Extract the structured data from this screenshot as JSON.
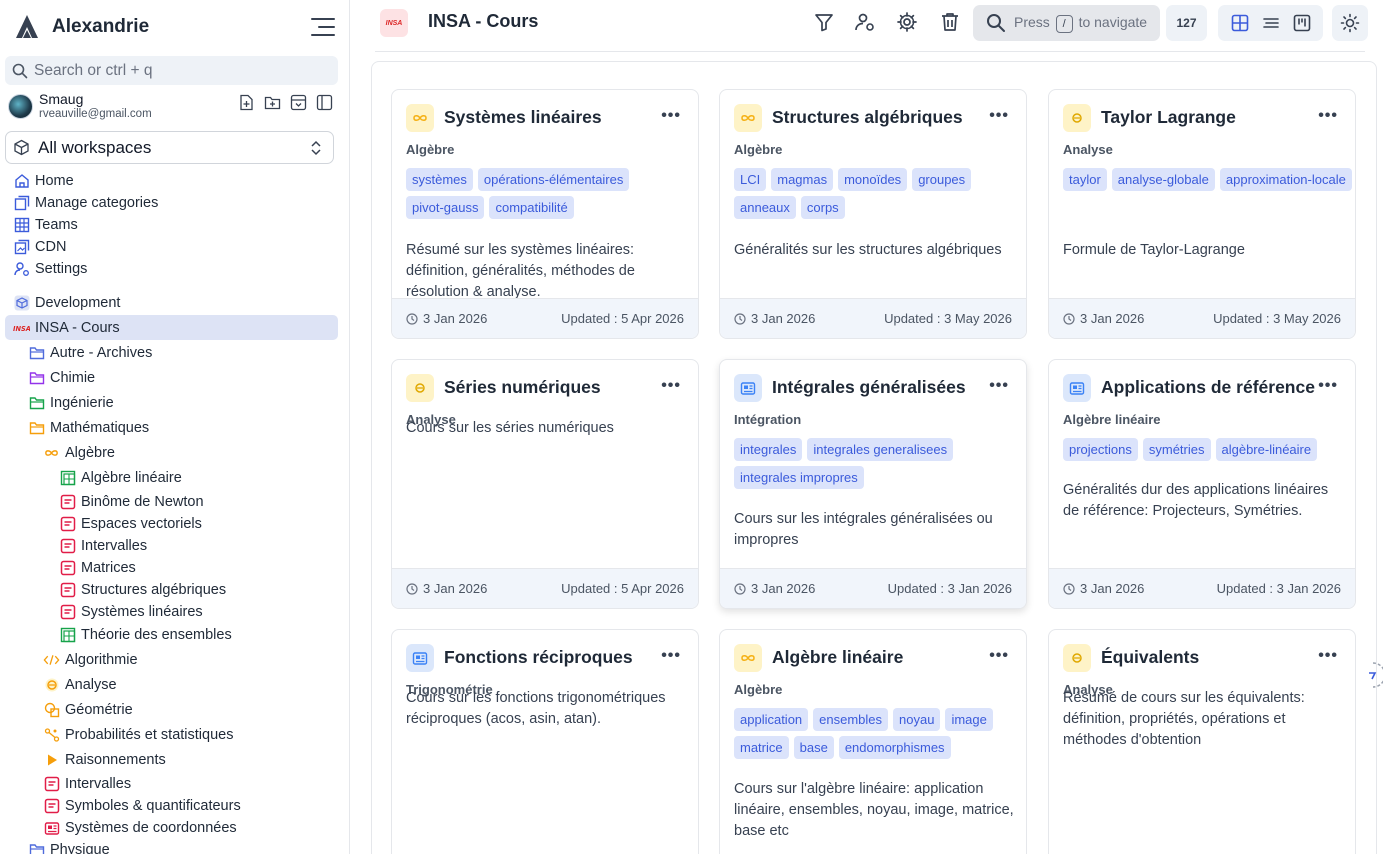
{
  "app": {
    "name": "Alexandrie"
  },
  "search": {
    "placeholder": "Search or ctrl + q"
  },
  "user": {
    "name": "Smaug",
    "email": "rveauville@gmail.com"
  },
  "workspace": {
    "label": "All workspaces"
  },
  "nav": [
    {
      "label": "Home",
      "icon": "home-icon"
    },
    {
      "label": "Manage categories",
      "icon": "categories-icon"
    },
    {
      "label": "Teams",
      "icon": "teams-icon"
    },
    {
      "label": "CDN",
      "icon": "cdn-icon"
    },
    {
      "label": "Settings",
      "icon": "settings-icon"
    }
  ],
  "tree": [
    {
      "label": "Development",
      "icon": "cube-icon",
      "color": "#4f6bdc"
    },
    {
      "label": "INSA - Cours",
      "icon": "insa-logo",
      "color": "#dc2626"
    },
    {
      "label": "Autre - Archives",
      "icon": "folder-icon",
      "color": "#4f6bdc"
    },
    {
      "label": "Chimie",
      "icon": "folder-icon",
      "color": "#9333ea"
    },
    {
      "label": "Ingénierie",
      "icon": "folder-icon",
      "color": "#16a34a"
    },
    {
      "label": "Mathématiques",
      "icon": "folder-icon",
      "color": "#f59e0b"
    },
    {
      "label": "Algèbre",
      "icon": "infinity-icon",
      "color": "#f59e0b"
    },
    {
      "label": "Algèbre linéaire",
      "icon": "board-icon",
      "color": "#16a34a"
    },
    {
      "label": "Binôme de Newton",
      "icon": "doc-icon",
      "color": "#e11d48"
    },
    {
      "label": "Espaces vectoriels",
      "icon": "doc-icon",
      "color": "#e11d48"
    },
    {
      "label": "Intervalles",
      "icon": "doc-icon",
      "color": "#e11d48"
    },
    {
      "label": "Matrices",
      "icon": "doc-icon",
      "color": "#e11d48"
    },
    {
      "label": "Structures algébriques",
      "icon": "doc-icon",
      "color": "#e11d48"
    },
    {
      "label": "Systèmes linéaires",
      "icon": "doc-icon",
      "color": "#e11d48"
    },
    {
      "label": "Théorie des ensembles",
      "icon": "board-icon",
      "color": "#16a34a"
    },
    {
      "label": "Algorithmie",
      "icon": "code-icon",
      "color": "#f59e0b"
    },
    {
      "label": "Analyse",
      "icon": "analysis-icon",
      "color": "#f59e0b"
    },
    {
      "label": "Géométrie",
      "icon": "geometry-icon",
      "color": "#f59e0b"
    },
    {
      "label": "Probabilités et statistiques",
      "icon": "stats-icon",
      "color": "#f59e0b"
    },
    {
      "label": "Raisonnements",
      "icon": "play-icon",
      "color": "#f59e0b"
    },
    {
      "label": "Intervalles",
      "icon": "doc-icon",
      "color": "#e11d48"
    },
    {
      "label": "Symboles & quantificateurs",
      "icon": "doc-icon",
      "color": "#e11d48"
    },
    {
      "label": "Systèmes de coordonnées",
      "icon": "news-icon",
      "color": "#e11d48"
    },
    {
      "label": "Physique",
      "icon": "folder-icon",
      "color": "#4f6bdc"
    }
  ],
  "topbar": {
    "title": "INSA - Cours",
    "logo_text": "INSA",
    "command": {
      "before": "Press",
      "key": "/",
      "after": "to navigate"
    },
    "count": "127"
  },
  "cards": [
    {
      "title": "Systèmes linéaires",
      "category": "Algèbre",
      "icon": "infinity-icon",
      "tags": [
        "systèmes",
        "opérations-élémentaires",
        "pivot-gauss",
        "compatibilité"
      ],
      "description": "Résumé sur les systèmes linéaires: définition, généralités, méthodes de résolution & analyse.",
      "created": "3 Jan 2026",
      "updated": "Updated : 5 Apr 2026"
    },
    {
      "title": "Structures algébriques",
      "category": "Algèbre",
      "icon": "infinity-icon",
      "tags": [
        "LCI",
        "magmas",
        "monoïdes",
        "groupes",
        "anneaux",
        "corps"
      ],
      "description": "Généralités sur les structures algébriques",
      "created": "3 Jan 2026",
      "updated": "Updated : 3 May 2026"
    },
    {
      "title": "Taylor Lagrange",
      "category": "Analyse",
      "icon": "analysis-icon",
      "tags": [
        "taylor",
        "analyse-globale",
        "approximation-locale"
      ],
      "description": "Formule de Taylor-Lagrange",
      "created": "3 Jan 2026",
      "updated": "Updated : 3 May 2026"
    },
    {
      "title": "Séries numériques",
      "category": "Analyse",
      "icon": "analysis-icon",
      "tags": [],
      "description": "Cours sur les séries numériques",
      "created": "3 Jan 2026",
      "updated": "Updated : 5 Apr 2026"
    },
    {
      "title": "Intégrales généralisées",
      "category": "Intégration",
      "icon": "news-icon",
      "tags": [
        "integrales",
        "integrales generalisees",
        "integrales impropres"
      ],
      "description": "Cours sur les intégrales généralisées ou impropres",
      "created": "3 Jan 2026",
      "updated": "Updated : 3 Jan 2026"
    },
    {
      "title": "Applications de référence",
      "category": "Algèbre linéaire",
      "icon": "news-icon",
      "tags": [
        "projections",
        "symétries",
        "algèbre-linéaire"
      ],
      "description": "Généralités dur des applications linéaires de référence: Projecteurs, Symétries.",
      "created": "3 Jan 2026",
      "updated": "Updated : 3 Jan 2026"
    },
    {
      "title": "Fonctions réciproques",
      "category": "Trigonométrie",
      "icon": "news-icon",
      "tags": [],
      "description": "Cours sur les fonctions trigonométriques réciproques (acos, asin, atan).",
      "created": "",
      "updated": ""
    },
    {
      "title": "Algèbre linéaire",
      "category": "Algèbre",
      "icon": "infinity-icon",
      "tags": [
        "application",
        "ensembles",
        "noyau",
        "image",
        "matrice",
        "base",
        "endomorphismes"
      ],
      "description": "Cours sur l'algèbre linéaire: application linéaire, ensembles, noyau, image, matrice, base etc",
      "created": "",
      "updated": ""
    },
    {
      "title": "Équivalents",
      "category": "Analyse",
      "icon": "analysis-icon",
      "tags": [],
      "description": "Résumé de cours sur les équivalents: définition, propriétés, opérations et méthodes d'obtention",
      "created": "",
      "updated": ""
    }
  ]
}
